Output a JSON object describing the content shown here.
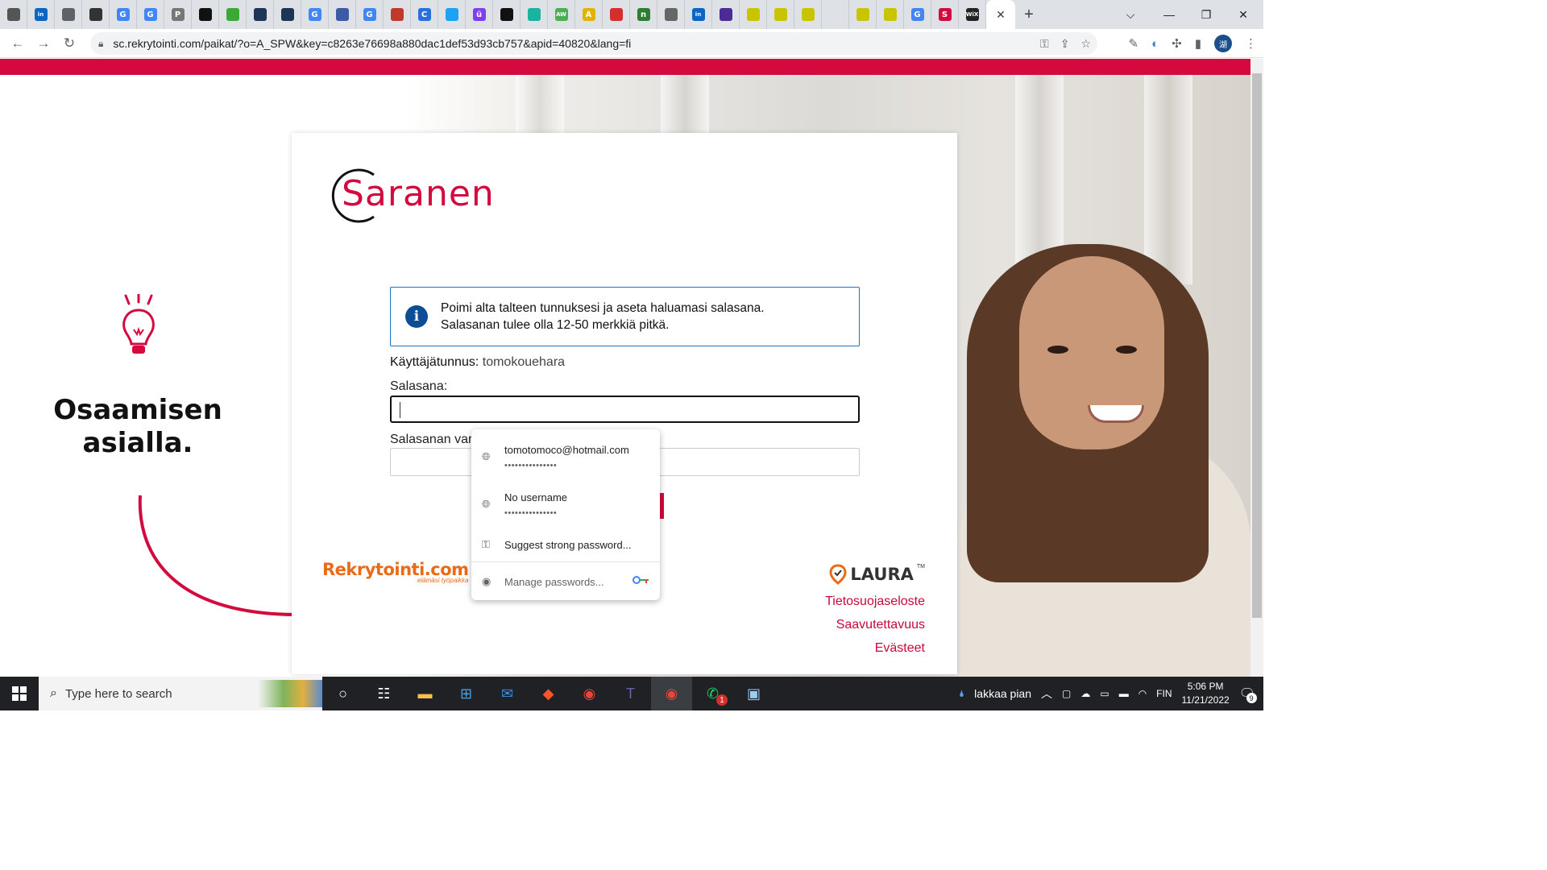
{
  "browser": {
    "tabs": [
      {
        "icon": "doc-icon",
        "color": "#555"
      },
      {
        "icon": "linkedin-icon",
        "color": "#0a66c2",
        "glyph": "in"
      },
      {
        "icon": "globe-icon",
        "color": "#5f6368"
      },
      {
        "icon": "line-icon",
        "color": "#333"
      },
      {
        "icon": "google-icon",
        "color": "#4285f4",
        "glyph": "G"
      },
      {
        "icon": "google-icon",
        "color": "#4285f4",
        "glyph": "G"
      },
      {
        "icon": "p-icon",
        "color": "#777",
        "glyph": "P"
      },
      {
        "icon": "github-icon",
        "color": "#111"
      },
      {
        "icon": "green-icon",
        "color": "#3aa935"
      },
      {
        "icon": "cube-icon",
        "color": "#1d3557"
      },
      {
        "icon": "cube-icon",
        "color": "#1d3557"
      },
      {
        "icon": "google-icon",
        "color": "#4285f4",
        "glyph": "G"
      },
      {
        "icon": "chart-icon",
        "color": "#3b5ba5"
      },
      {
        "icon": "google-icon",
        "color": "#4285f4",
        "glyph": "G"
      },
      {
        "icon": "triangle-icon",
        "color": "#c0392b"
      },
      {
        "icon": "c-icon",
        "color": "#2a6fdb",
        "glyph": "C"
      },
      {
        "icon": "bird-icon",
        "color": "#1da1f2"
      },
      {
        "icon": "u-icon",
        "color": "#7e3ff2",
        "glyph": "ü"
      },
      {
        "icon": "github-icon",
        "color": "#111"
      },
      {
        "icon": "heart-icon",
        "color": "#19b3a1"
      },
      {
        "icon": "aw-icon",
        "color": "#4caf50",
        "glyph": "AW"
      },
      {
        "icon": "a-icon",
        "color": "#e2b400",
        "glyph": "A"
      },
      {
        "icon": "x-icon",
        "color": "#d32f2f"
      },
      {
        "icon": "n-icon",
        "color": "#2e7d32",
        "glyph": "n"
      },
      {
        "icon": "doc-icon",
        "color": "#666"
      },
      {
        "icon": "linkedin-icon",
        "color": "#0a66c2",
        "glyph": "in"
      },
      {
        "icon": "dot-icon",
        "color": "#4b2c96"
      },
      {
        "icon": "shield-icon",
        "color": "#c9c400"
      },
      {
        "icon": "shield-icon",
        "color": "#c9c400"
      },
      {
        "icon": "shield-icon",
        "color": "#c9c400"
      },
      {
        "icon": "blank-icon",
        "color": "#dee1e6"
      },
      {
        "icon": "shield-icon",
        "color": "#c9c400"
      },
      {
        "icon": "shield-icon",
        "color": "#c9c400"
      },
      {
        "icon": "google-icon",
        "color": "#4285f4",
        "glyph": "G"
      },
      {
        "icon": "s-icon",
        "color": "#d4093d",
        "glyph": "S"
      },
      {
        "icon": "wix-icon",
        "color": "#222",
        "glyph": "WiX"
      }
    ],
    "url": "sc.rekrytointi.com/paikat/?o=A_SPW&key=c8263e76698a880dac1def53d93cb757&apid=40820&lang=fi",
    "profile_initial": "湖"
  },
  "left": {
    "slogan_line1": "Osaamisen",
    "slogan_line2": "asialla."
  },
  "card": {
    "logo_text": "Saranen",
    "info_line1": "Poimi alta talteen tunnuksesi ja aseta haluamasi salasana.",
    "info_line2": "Salasanan tulee olla 12-50 merkkiä pitkä.",
    "username_label": "Käyttäjätunnus:",
    "username_value": "tomokouehara",
    "password_label": "Salasana:",
    "password_confirm_label": "Salasanan varı",
    "rekry_logo": "Rekrytointi.com",
    "rekry_tagline": "elämäsi työpaikka",
    "laura_logo": "LAURA",
    "laura_tm": "TM",
    "links": [
      "Tietosuojaseloste",
      "Saavutettavuus",
      "Evästeet"
    ]
  },
  "password_popup": {
    "entries": [
      {
        "username": "tomotomoco@hotmail.com",
        "password_mask": "•••••••••••••••"
      },
      {
        "username": "No username",
        "password_mask": "•••••••••••••••"
      }
    ],
    "suggest": "Suggest strong password...",
    "manage": "Manage passwords..."
  },
  "taskbar": {
    "search_placeholder": "Type here to search",
    "weather_text": "lakkaa pian",
    "language": "FIN",
    "time": "5:06 PM",
    "date": "11/21/2022",
    "notifications": "9",
    "whatsapp_badge": "1"
  }
}
